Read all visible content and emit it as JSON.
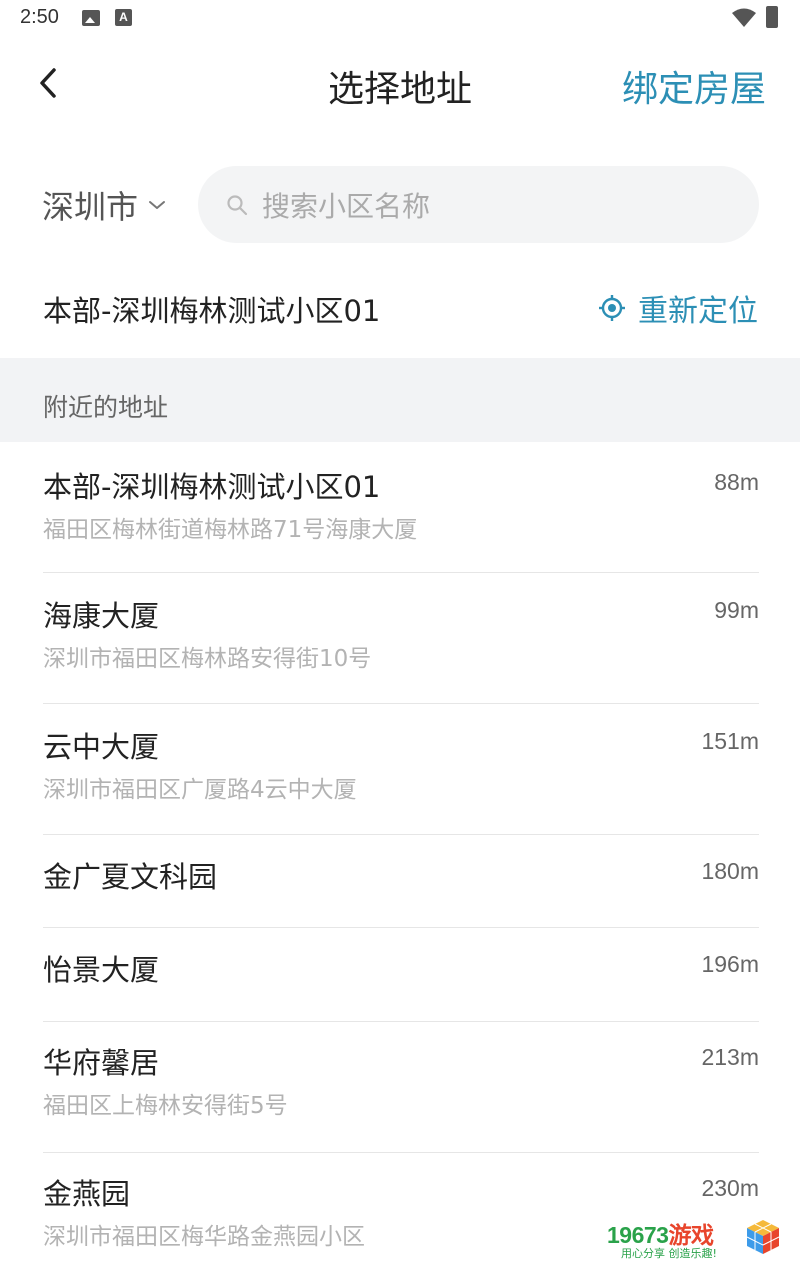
{
  "status_bar": {
    "time": "2:50"
  },
  "header": {
    "title": "选择地址",
    "bind_label": "绑定房屋"
  },
  "search": {
    "city": "深圳市",
    "placeholder": "搜索小区名称"
  },
  "current_location": {
    "name": "本部-深圳梅林测试小区01",
    "relocate_label": "重新定位"
  },
  "nearby": {
    "title": "附近的地址",
    "items": [
      {
        "name": "本部-深圳梅林测试小区01",
        "address": "福田区梅林街道梅林路71号海康大厦",
        "distance": "88m"
      },
      {
        "name": "海康大厦",
        "address": "深圳市福田区梅林路安得街10号",
        "distance": "99m"
      },
      {
        "name": "云中大厦",
        "address": "深圳市福田区广厦路4云中大厦",
        "distance": "151m"
      },
      {
        "name": "金广夏文科园",
        "address": "",
        "distance": "180m"
      },
      {
        "name": "怡景大厦",
        "address": "",
        "distance": "196m"
      },
      {
        "name": "华府馨居",
        "address": "福田区上梅林安得街5号",
        "distance": "213m"
      },
      {
        "name": "金燕园",
        "address": "深圳市福田区梅华路金燕园小区",
        "distance": "230m"
      }
    ]
  },
  "watermark": {
    "brand_num": "19673",
    "brand_cn": "游戏",
    "slogan": "用心分享 创造乐趣!"
  },
  "colors": {
    "accent": "#2c8fb5",
    "section_bg": "#f2f3f5",
    "search_bg": "#f3f4f5",
    "muted_text": "#b3b3b3"
  }
}
